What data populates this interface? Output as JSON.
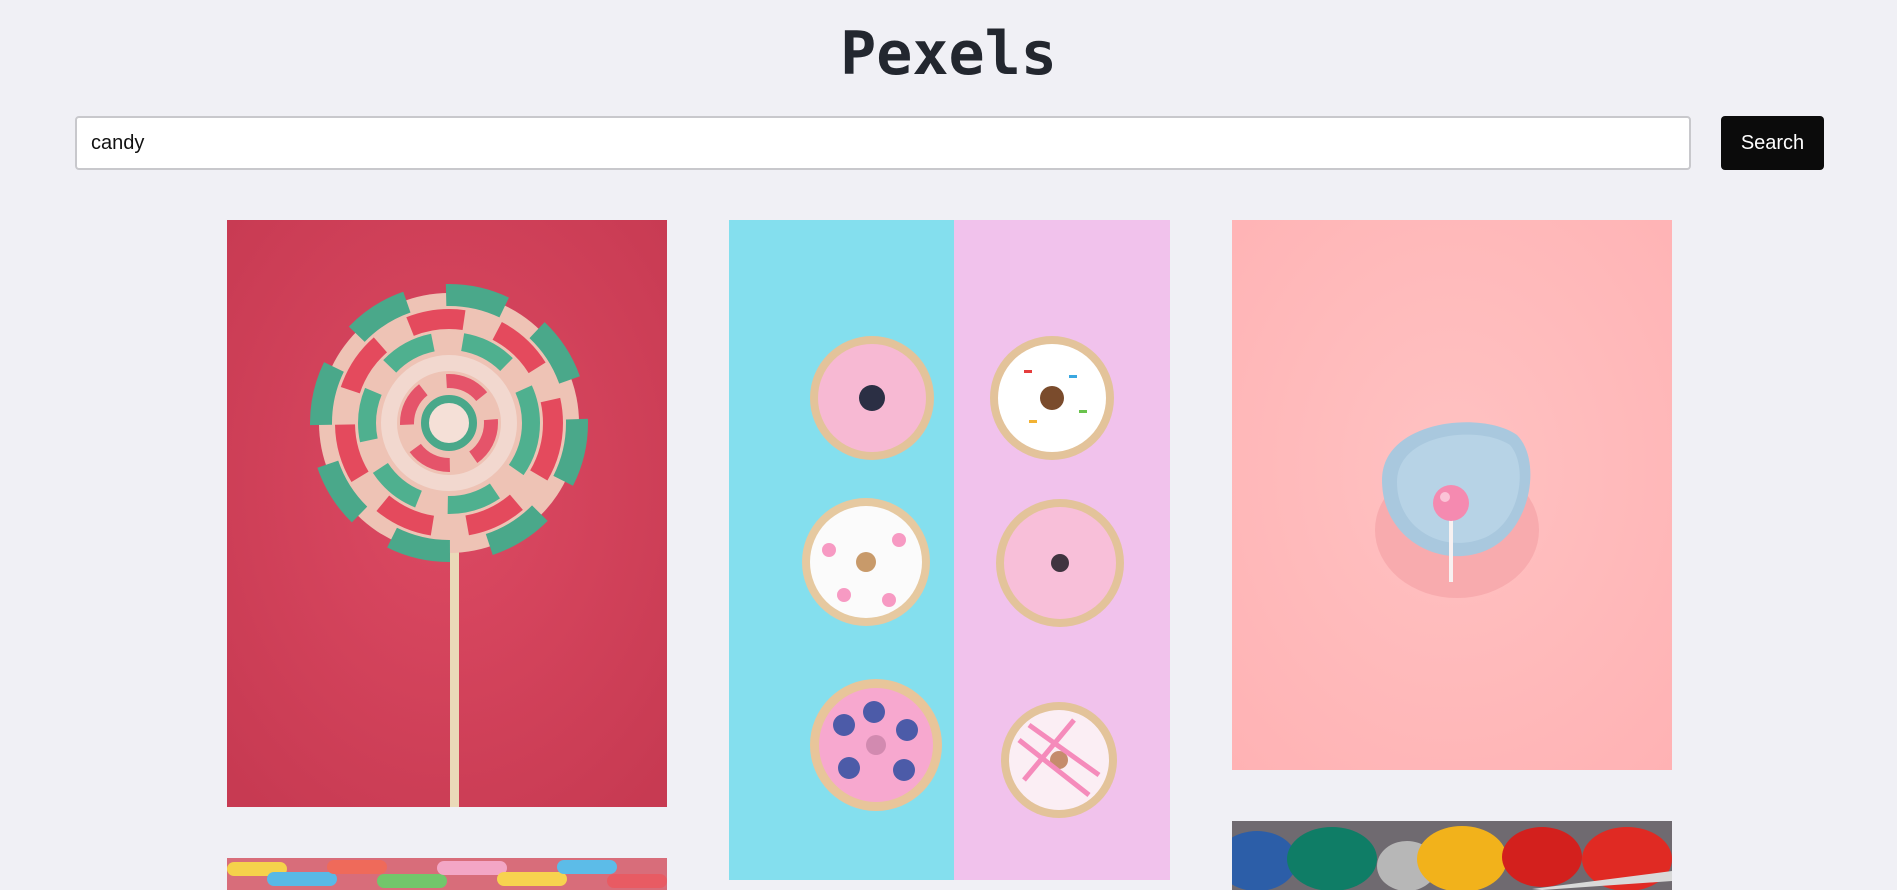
{
  "header": {
    "title": "Pexels"
  },
  "search": {
    "value": "candy",
    "button_label": "Search"
  },
  "photos": [
    {
      "name": "lollipop-swirl-photo",
      "subject": "swirl-lollipop"
    },
    {
      "name": "donuts-photo",
      "subject": "donuts"
    },
    {
      "name": "pink-lollipop-plate-photo",
      "subject": "lollipop-on-plate"
    },
    {
      "name": "gummy-worms-photo",
      "subject": "gummy-worms"
    },
    {
      "name": "gummy-bears-photo",
      "subject": "gummy-bears"
    }
  ],
  "colors": {
    "background": "#f0f0f5",
    "button": "#0b0b0b",
    "title": "#23272f"
  }
}
